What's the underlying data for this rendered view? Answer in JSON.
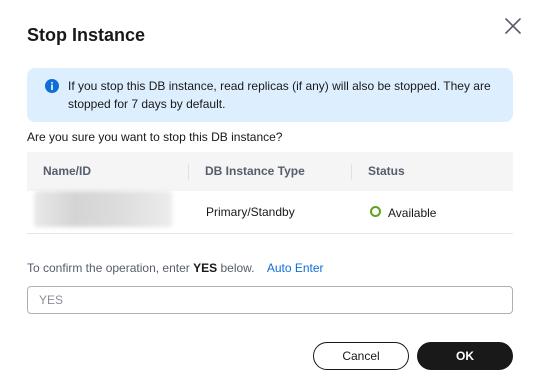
{
  "dialog": {
    "title": "Stop Instance",
    "close_icon": "close-icon"
  },
  "alert": {
    "icon": "info-icon",
    "text": "If you stop this DB instance, read replicas (if any) will also be stopped. They are stopped for 7 days by default."
  },
  "question": "Are you sure you want to stop this DB instance?",
  "table": {
    "headers": [
      "Name/ID",
      "DB Instance Type",
      "Status"
    ],
    "rows": [
      {
        "name_id": "",
        "type": "Primary/Standby",
        "status": "Available"
      }
    ]
  },
  "confirm": {
    "prefix": "To confirm the operation, enter",
    "keyword": "YES",
    "suffix": "below.",
    "auto_enter": "Auto Enter",
    "input_value": "",
    "input_placeholder": "YES"
  },
  "buttons": {
    "cancel": "Cancel",
    "ok": "OK"
  },
  "colors": {
    "alert_bg": "#ddeeff",
    "info_icon": "#0d6fd6",
    "link": "#0d6fd6",
    "status_available": "#5aa516",
    "primary_button": "#191919"
  }
}
